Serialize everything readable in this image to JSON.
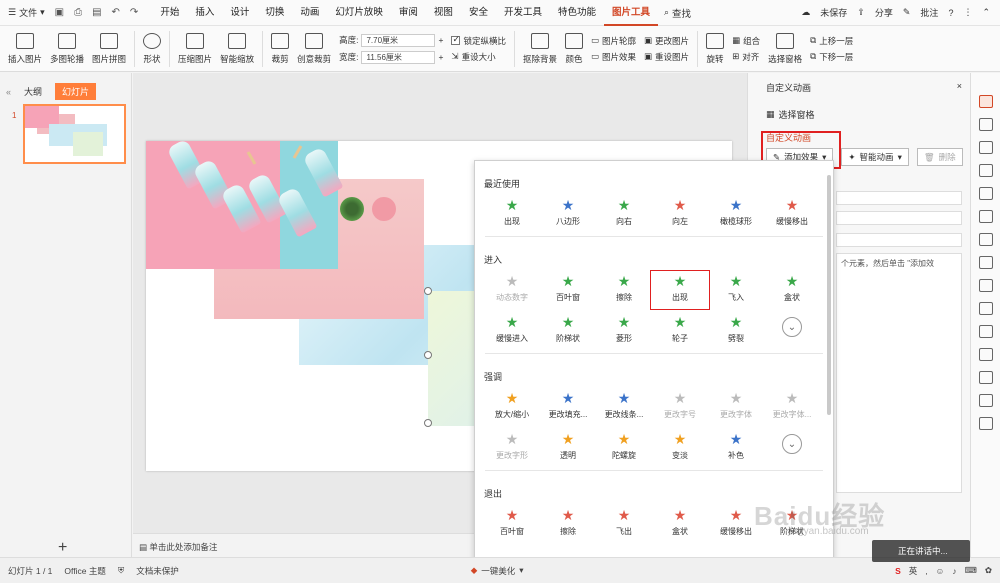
{
  "menubar": {
    "file_label": "文件",
    "tabs": [
      "开始",
      "插入",
      "设计",
      "切换",
      "动画",
      "幻灯片放映",
      "审阅",
      "视图",
      "安全",
      "开发工具",
      "特色功能",
      "图片工具"
    ],
    "active_tab": "图片工具",
    "search_label": "查找",
    "unsaved_label": "未保存",
    "share_label": "分享",
    "comment_label": "批注"
  },
  "ribbon": {
    "insert_picture": "插入图片",
    "multi_carousel": "多图轮播",
    "picture_collage": "图片拼图",
    "shape": "形状",
    "compress": "压缩图片",
    "smart_zoom": "智能缩放",
    "crop": "裁剪",
    "creative_crop": "创意裁剪",
    "height_label": "高度:",
    "height_value": "7.70厘米",
    "width_label": "宽度:",
    "width_value": "11.56厘米",
    "lock_ratio": "锁定纵横比",
    "reset_size": "重设大小",
    "remove_bg": "抠除背景",
    "color": "颜色",
    "picture_outline": "图片轮廓",
    "picture_effects": "图片效果",
    "change_picture": "更改图片",
    "reset_picture": "重设图片",
    "rotate": "旋转",
    "group": "组合",
    "align": "对齐",
    "selection_pane": "选择窗格",
    "bring_forward": "上移一层",
    "send_backward": "下移一层"
  },
  "left_panel": {
    "tab_outline": "大纲",
    "tab_slides": "幻灯片",
    "slide_number": "1",
    "add_symbol": "+"
  },
  "notes_placeholder": "单击此处添加备注",
  "dropdown": {
    "sections": [
      {
        "title": "最近使用",
        "items": [
          {
            "label": "出现",
            "color": "#3aa84a",
            "dim": false
          },
          {
            "label": "八边形",
            "color": "#3b73c9",
            "dim": false
          },
          {
            "label": "向右",
            "color": "#3aa84a",
            "dim": false
          },
          {
            "label": "向左",
            "color": "#e05a4a",
            "dim": false
          },
          {
            "label": "橄榄球形",
            "color": "#3b73c9",
            "dim": false
          },
          {
            "label": "缓慢移出",
            "color": "#e05a4a",
            "dim": false
          }
        ]
      },
      {
        "title": "进入",
        "items": [
          {
            "label": "动态数字",
            "color": "#bbbbbb",
            "dim": true
          },
          {
            "label": "百叶窗",
            "color": "#3aa84a",
            "dim": false
          },
          {
            "label": "擦除",
            "color": "#3aa84a",
            "dim": false
          },
          {
            "label": "出现",
            "color": "#3aa84a",
            "dim": false,
            "selected": true
          },
          {
            "label": "飞入",
            "color": "#3aa84a",
            "dim": false
          },
          {
            "label": "盒状",
            "color": "#3aa84a",
            "dim": false
          },
          {
            "label": "缓慢进入",
            "color": "#3aa84a",
            "dim": false
          },
          {
            "label": "阶梯状",
            "color": "#3aa84a",
            "dim": false
          },
          {
            "label": "菱形",
            "color": "#3aa84a",
            "dim": false
          },
          {
            "label": "轮子",
            "color": "#3aa84a",
            "dim": false
          },
          {
            "label": "劈裂",
            "color": "#3aa84a",
            "dim": false
          }
        ]
      },
      {
        "title": "强调",
        "items": [
          {
            "label": "放大/缩小",
            "color": "#f0a020",
            "dim": false
          },
          {
            "label": "更改填充...",
            "color": "#3b73c9",
            "dim": false
          },
          {
            "label": "更改线条...",
            "color": "#3b73c9",
            "dim": false
          },
          {
            "label": "更改字号",
            "color": "#bbbbbb",
            "dim": true
          },
          {
            "label": "更改字体",
            "color": "#bbbbbb",
            "dim": true
          },
          {
            "label": "更改字体...",
            "color": "#bbbbbb",
            "dim": true
          },
          {
            "label": "更改字形",
            "color": "#bbbbbb",
            "dim": true
          },
          {
            "label": "透明",
            "color": "#f0a020",
            "dim": false
          },
          {
            "label": "陀螺旋",
            "color": "#f0a020",
            "dim": false
          },
          {
            "label": "变淡",
            "color": "#f0a020",
            "dim": false
          },
          {
            "label": "补色",
            "color": "#3b73c9",
            "dim": false
          }
        ]
      },
      {
        "title": "退出",
        "items": [
          {
            "label": "百叶窗",
            "color": "#e05a4a",
            "dim": false
          },
          {
            "label": "擦除",
            "color": "#e05a4a",
            "dim": false
          },
          {
            "label": "飞出",
            "color": "#e05a4a",
            "dim": false
          },
          {
            "label": "盒状",
            "color": "#e05a4a",
            "dim": false
          },
          {
            "label": "缓慢移出",
            "color": "#e05a4a",
            "dim": false
          },
          {
            "label": "阶梯状",
            "color": "#e05a4a",
            "dim": false
          }
        ]
      }
    ]
  },
  "taskpane": {
    "title": "自定义动画",
    "selection_pane": "选择窗格",
    "section_label": "自定义动画",
    "add_effect": "添加效果",
    "smart_animation": "智能动画",
    "delete": "删除",
    "hint_text": "个元素，然后单击 \"添加效"
  },
  "statusbar": {
    "slide_info": "幻灯片 1 / 1",
    "theme": "Office 主题",
    "doc_status": "文档未保护",
    "beautify": "一键美化",
    "ime_label": "英"
  },
  "overlay": {
    "watermark": "Baidu经验",
    "watermark_sub": "jingyan.baidu.com",
    "toast": "正在讲话中..."
  }
}
